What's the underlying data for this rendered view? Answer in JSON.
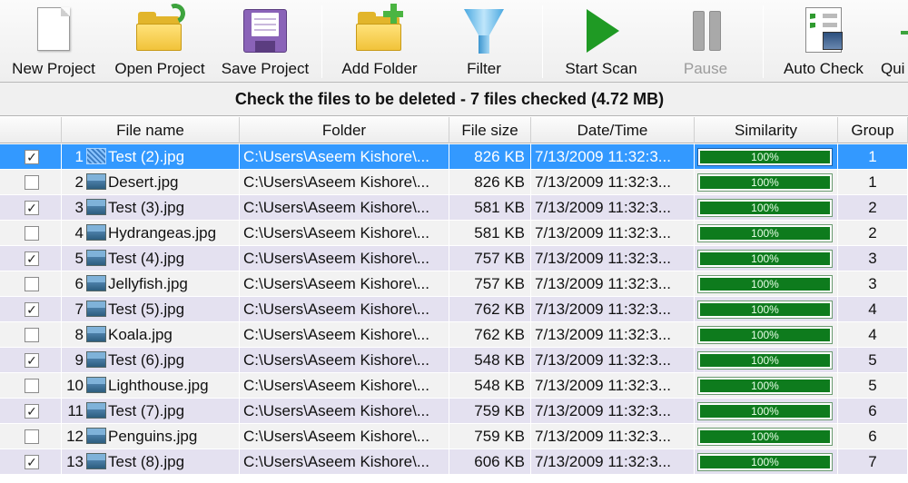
{
  "toolbar": {
    "buttons": [
      {
        "label": "New Project",
        "icon": "new-page-icon"
      },
      {
        "label": "Open Project",
        "icon": "open-folder-icon"
      },
      {
        "label": "Save Project",
        "icon": "floppy-disk-icon"
      },
      {
        "label": "Add Folder",
        "icon": "add-folder-icon"
      },
      {
        "label": "Filter",
        "icon": "funnel-icon"
      },
      {
        "label": "Start Scan",
        "icon": "play-icon"
      },
      {
        "label": "Pause",
        "icon": "pause-icon",
        "disabled": true
      },
      {
        "label": "Auto Check",
        "icon": "checklist-icon"
      },
      {
        "label": "Qui",
        "icon": "quit-icon"
      }
    ]
  },
  "banner": {
    "text": "Check the files to be deleted - 7 files checked (4.72 MB)"
  },
  "table": {
    "columns": [
      "File name",
      "Folder",
      "File size",
      "Date/Time",
      "Similarity",
      "Group"
    ],
    "rows": [
      {
        "checked": true,
        "num": "1",
        "name": "Test (2).jpg",
        "folder": "C:\\Users\\Aseem Kishore\\...",
        "size": "826 KB",
        "date": "7/13/2009 11:32:3...",
        "similarity": "100%",
        "group": "1",
        "selected": true
      },
      {
        "checked": false,
        "num": "2",
        "name": "Desert.jpg",
        "folder": "C:\\Users\\Aseem Kishore\\...",
        "size": "826 KB",
        "date": "7/13/2009 11:32:3...",
        "similarity": "100%",
        "group": "1"
      },
      {
        "checked": true,
        "num": "3",
        "name": "Test (3).jpg",
        "folder": "C:\\Users\\Aseem Kishore\\...",
        "size": "581 KB",
        "date": "7/13/2009 11:32:3...",
        "similarity": "100%",
        "group": "2"
      },
      {
        "checked": false,
        "num": "4",
        "name": "Hydrangeas.jpg",
        "folder": "C:\\Users\\Aseem Kishore\\...",
        "size": "581 KB",
        "date": "7/13/2009 11:32:3...",
        "similarity": "100%",
        "group": "2"
      },
      {
        "checked": true,
        "num": "5",
        "name": "Test (4).jpg",
        "folder": "C:\\Users\\Aseem Kishore\\...",
        "size": "757 KB",
        "date": "7/13/2009 11:32:3...",
        "similarity": "100%",
        "group": "3"
      },
      {
        "checked": false,
        "num": "6",
        "name": "Jellyfish.jpg",
        "folder": "C:\\Users\\Aseem Kishore\\...",
        "size": "757 KB",
        "date": "7/13/2009 11:32:3...",
        "similarity": "100%",
        "group": "3"
      },
      {
        "checked": true,
        "num": "7",
        "name": "Test (5).jpg",
        "folder": "C:\\Users\\Aseem Kishore\\...",
        "size": "762 KB",
        "date": "7/13/2009 11:32:3...",
        "similarity": "100%",
        "group": "4"
      },
      {
        "checked": false,
        "num": "8",
        "name": "Koala.jpg",
        "folder": "C:\\Users\\Aseem Kishore\\...",
        "size": "762 KB",
        "date": "7/13/2009 11:32:3...",
        "similarity": "100%",
        "group": "4"
      },
      {
        "checked": true,
        "num": "9",
        "name": "Test (6).jpg",
        "folder": "C:\\Users\\Aseem Kishore\\...",
        "size": "548 KB",
        "date": "7/13/2009 11:32:3...",
        "similarity": "100%",
        "group": "5"
      },
      {
        "checked": false,
        "num": "10",
        "name": "Lighthouse.jpg",
        "folder": "C:\\Users\\Aseem Kishore\\...",
        "size": "548 KB",
        "date": "7/13/2009 11:32:3...",
        "similarity": "100%",
        "group": "5"
      },
      {
        "checked": true,
        "num": "11",
        "name": "Test (7).jpg",
        "folder": "C:\\Users\\Aseem Kishore\\...",
        "size": "759 KB",
        "date": "7/13/2009 11:32:3...",
        "similarity": "100%",
        "group": "6"
      },
      {
        "checked": false,
        "num": "12",
        "name": "Penguins.jpg",
        "folder": "C:\\Users\\Aseem Kishore\\...",
        "size": "759 KB",
        "date": "7/13/2009 11:32:3...",
        "similarity": "100%",
        "group": "6"
      },
      {
        "checked": true,
        "num": "13",
        "name": "Test (8).jpg",
        "folder": "C:\\Users\\Aseem Kishore\\...",
        "size": "606 KB",
        "date": "7/13/2009 11:32:3...",
        "similarity": "100%",
        "group": "7"
      }
    ]
  },
  "colors": {
    "selection": "#3399ff",
    "similarity_bar": "#0e7b1d",
    "row_alt": "#e4e1f0",
    "row": "#f2f2f2"
  }
}
